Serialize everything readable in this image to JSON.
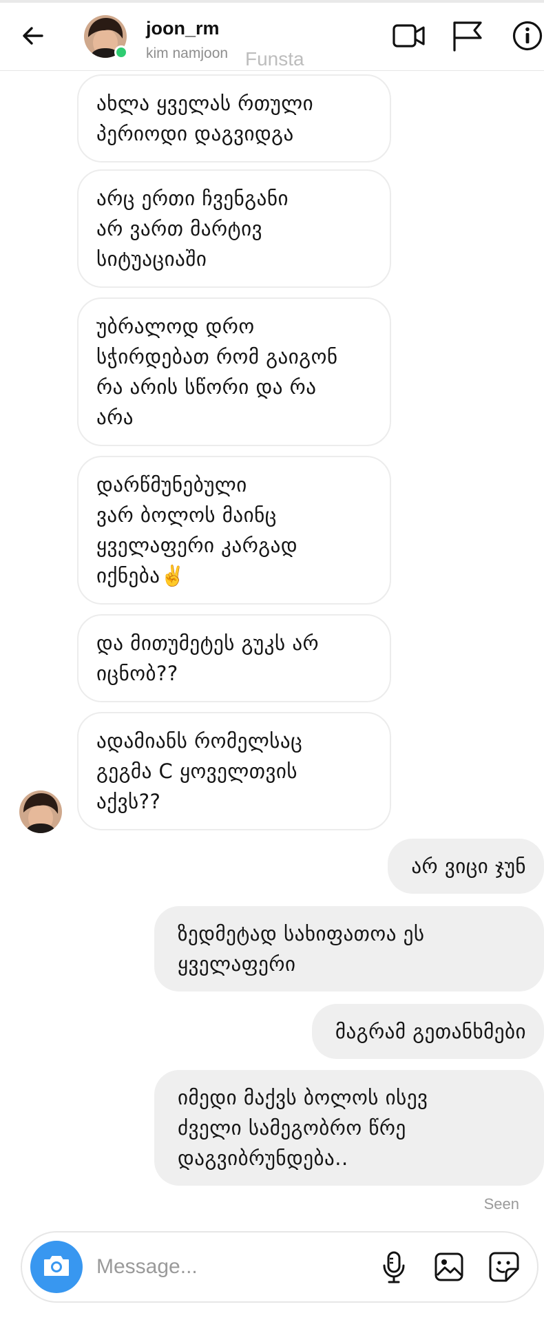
{
  "header": {
    "username": "joon_rm",
    "full_name": "kim namjoon",
    "watermark": "Funsta",
    "online": true
  },
  "icons": {
    "back": "arrow-left-icon",
    "video_call": "video-camera-icon",
    "report": "flag-icon",
    "info": "info-icon",
    "camera": "camera-icon",
    "mic": "microphone-icon",
    "gallery": "image-icon",
    "sticker": "sticker-icon"
  },
  "colors": {
    "accent": "#3897f0",
    "online": "#2ecc71",
    "incoming_bubble": "#ffffff",
    "outgoing_bubble": "#efefef"
  },
  "messages": [
    {
      "side": "incoming",
      "text": "ახლა ყველას რთული\nპერიოდი დაგვიდგა"
    },
    {
      "side": "incoming",
      "text": "არც ერთი ჩვენგანი\nარ ვართ მარტივ\nსიტუაციაში"
    },
    {
      "side": "incoming",
      "text": "უბრალოდ დრო\nსჭირდებათ რომ გაიგონ\nრა არის სწორი და რა\nარა"
    },
    {
      "side": "incoming",
      "text": "დარწმუნებული\nვარ ბოლოს მაინც\nყველაფერი კარგად\nიქნება✌️"
    },
    {
      "side": "incoming",
      "text": "და მითუმეტეს გუკს არ\nიცნობ??"
    },
    {
      "side": "incoming",
      "text": "ადამიანს რომელსაც\nგეგმა C ყოველთვის\nაქვს??"
    },
    {
      "side": "outgoing",
      "text": "არ ვიცი ჯუნ"
    },
    {
      "side": "outgoing",
      "text": "ზედმეტად სახიფათოა ეს\nყველაფერი"
    },
    {
      "side": "outgoing",
      "text": "მაგრამ გეთანხმები"
    },
    {
      "side": "outgoing",
      "text": "იმედი მაქვს ბოლოს ისევ\nძველი სამეგობრო წრე\nდაგვიბრუნდება.."
    }
  ],
  "status": {
    "seen_label": "Seen"
  },
  "composer": {
    "placeholder": "Message..."
  }
}
